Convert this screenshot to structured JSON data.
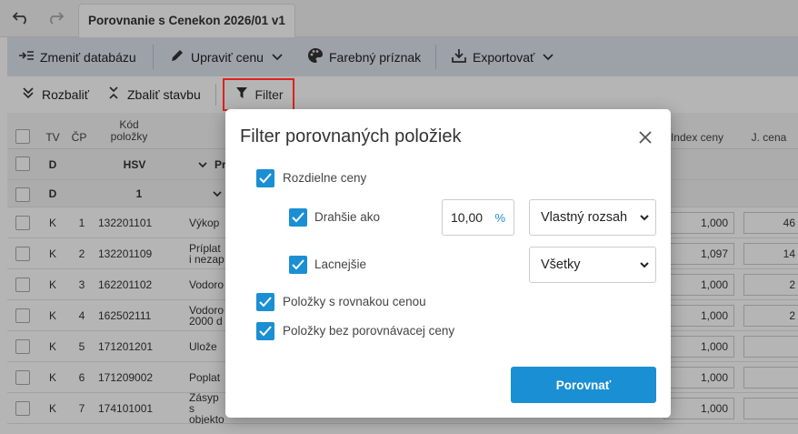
{
  "titlebar": {
    "undo_icon": "undo-icon",
    "redo_icon": "redo-icon",
    "tab_title": "Porovnanie s Cenekon 2026/01 v1"
  },
  "toolbar": {
    "change_db": "Zmeniť databázu",
    "edit_price": "Upraviť cenu",
    "color_flag": "Farebný príznak",
    "export": "Exportovať"
  },
  "toolbar2": {
    "expand": "Rozbaliť",
    "collapse": "Zbaliť stavbu",
    "filter": "Filter"
  },
  "grid": {
    "headers": {
      "tv": "TV",
      "cp": "ČP",
      "code": "Kód\npoložky",
      "index": "Index ceny",
      "unit_price": "J. cena"
    },
    "group_rows": [
      {
        "tv": "D",
        "code": "HSV",
        "desc": "Pr"
      },
      {
        "tv": "D",
        "code": "1",
        "desc": ""
      }
    ],
    "rows": [
      {
        "tv": "K",
        "cp": "1",
        "code": "132201101",
        "desc": "Výkop",
        "index": "1,000",
        "price": "46"
      },
      {
        "tv": "K",
        "cp": "2",
        "code": "132201109",
        "desc": "Príplat\ni nezap",
        "index": "1,097",
        "price": "14"
      },
      {
        "tv": "K",
        "cp": "3",
        "code": "162201102",
        "desc": "Vodoro",
        "index": "1,000",
        "price": "2"
      },
      {
        "tv": "K",
        "cp": "4",
        "code": "162502111",
        "desc": "Vodoro\n2000 d",
        "index": "1,000",
        "price": "2"
      },
      {
        "tv": "K",
        "cp": "5",
        "code": "171201201",
        "desc": "Ulože",
        "index": "1,000",
        "price": ""
      },
      {
        "tv": "K",
        "cp": "6",
        "code": "171209002",
        "desc": "Poplat",
        "index": "1,000",
        "price": ""
      },
      {
        "tv": "K",
        "cp": "7",
        "code": "174101001",
        "desc": "Zásyp s\nobjekto",
        "index": "1,000",
        "price": ""
      }
    ]
  },
  "modal": {
    "title": "Filter porovnaných položiek",
    "close_icon": "close-icon",
    "different_prices": "Rozdielne ceny",
    "more_expensive": "Drahšie ako",
    "percent_value": "10,00",
    "percent_unit": "%",
    "range_select": "Vlastný rozsah",
    "cheaper": "Lacnejšie",
    "cheaper_select": "Všetky",
    "same_price": "Položky s rovnakou cenou",
    "no_compare_price": "Položky bez porovnávacej ceny",
    "compare_button": "Porovnať",
    "accent": "#1a8fd3"
  }
}
